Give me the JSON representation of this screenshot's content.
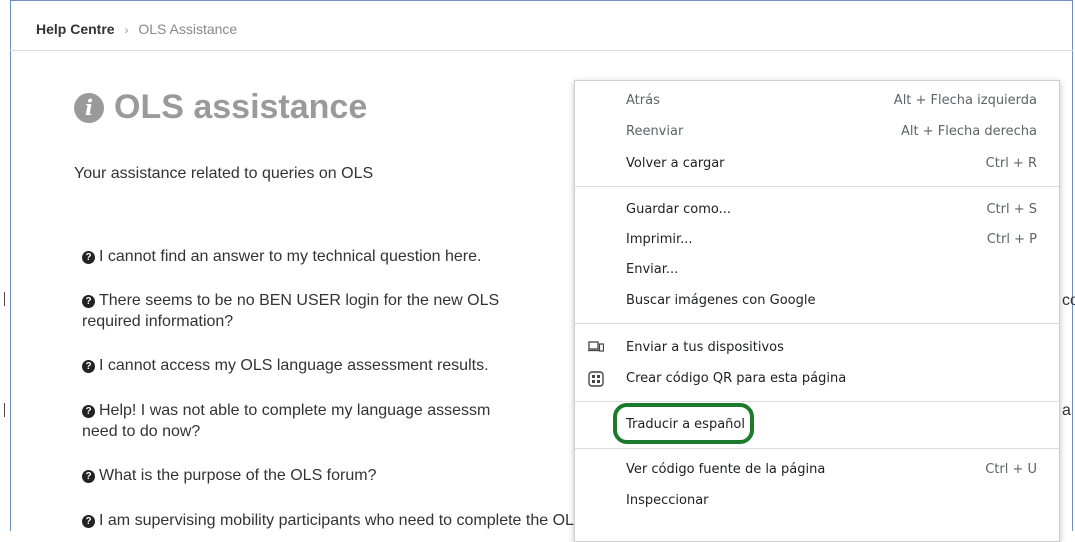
{
  "breadcrumb": {
    "home": "Help Centre",
    "separator": "›",
    "current": "OLS Assistance"
  },
  "page": {
    "title": "OLS assistance",
    "subtitle": "Your assistance related to queries on OLS",
    "faqs": [
      "I cannot find an answer to my technical question here.",
      "There seems to be no BEN USER login for the new OLS",
      "required information?",
      "I cannot access my OLS language assessment results.",
      "Help! I was not able to complete my language assessm",
      "need to do now?",
      "What is the purpose of the OLS forum?",
      "I am supervising mobility participants who need to complete the OLS language assessment. What should I tell the"
    ],
    "right_fragments": {
      "row2": "co",
      "row4": "a"
    }
  },
  "context_menu": {
    "items": [
      {
        "label": "Atrás",
        "shortcut": "Alt + Flecha izquierda",
        "enabled": false
      },
      {
        "label": "Reenviar",
        "shortcut": "Alt + Flecha derecha",
        "enabled": false
      },
      {
        "label": "Volver a cargar",
        "shortcut": "Ctrl + R",
        "enabled": true
      },
      {
        "label": "Guardar como...",
        "shortcut": "Ctrl + S",
        "enabled": true
      },
      {
        "label": "Imprimir...",
        "shortcut": "Ctrl + P",
        "enabled": true
      },
      {
        "label": "Enviar...",
        "shortcut": "",
        "enabled": true
      },
      {
        "label": "Buscar imágenes con Google",
        "shortcut": "",
        "enabled": true
      },
      {
        "label": "Enviar a tus dispositivos",
        "shortcut": "",
        "icon": "devices-icon",
        "enabled": true
      },
      {
        "label": "Crear código QR para esta página",
        "shortcut": "",
        "icon": "qr-code-icon",
        "enabled": true
      },
      {
        "label": "Traducir a español",
        "shortcut": "",
        "enabled": true,
        "highlighted": true
      },
      {
        "label": "Ver código fuente de la página",
        "shortcut": "Ctrl + U",
        "enabled": true
      },
      {
        "label": "Inspeccionar",
        "shortcut": "",
        "enabled": true
      }
    ],
    "highlight_color": "#1c7a2c"
  }
}
